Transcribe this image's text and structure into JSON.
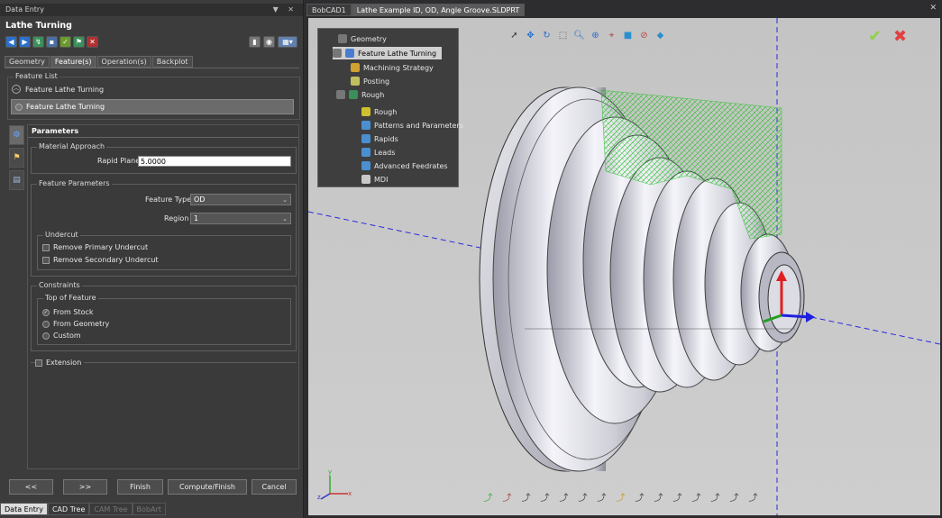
{
  "left_panel": {
    "pane_title": "Data Entry",
    "pane_btns": "▼ ✕",
    "feature_title": "Lathe Turning",
    "tabs": [
      "Geometry",
      "Feature(s)",
      "Operation(s)",
      "Backplot"
    ],
    "feature_list": {
      "legend": "Feature List",
      "group": "Feature Lathe Turning",
      "selected": "Feature Lathe Turning"
    },
    "params_header": "Parameters",
    "material_approach": {
      "legend": "Material Approach",
      "rapid_plane_label": "Rapid Plane",
      "rapid_plane_value": "5.0000"
    },
    "feature_parameters": {
      "legend": "Feature Parameters",
      "feature_type_label": "Feature Type",
      "feature_type_value": "OD",
      "region_label": "Region",
      "region_value": "1"
    },
    "undercut": {
      "legend": "Undercut",
      "remove_primary": "Remove Primary Undercut",
      "remove_secondary": "Remove Secondary Undercut"
    },
    "constraints": {
      "legend": "Constraints",
      "top_of_feature": "Top of Feature",
      "from_stock": "From Stock",
      "from_geometry": "From Geometry",
      "custom": "Custom"
    },
    "extension": "Extension",
    "buttons": {
      "prev": "<<",
      "next": ">>",
      "finish": "Finish",
      "compute_finish": "Compute/Finish",
      "cancel": "Cancel"
    },
    "dock_tabs": [
      "Data Entry",
      "CAD Tree",
      "CAM Tree",
      "BobArt"
    ]
  },
  "right_panel": {
    "tabs": [
      "BobCAD1",
      "Lathe Example ID, OD, Angle Groove.SLDPRT"
    ],
    "close": "✕",
    "tree": {
      "geometry": "Geometry",
      "feature": "Feature Lathe Turning",
      "machining_strategy": "Machining Strategy",
      "posting": "Posting",
      "rough": "Rough",
      "rough_child": "Rough",
      "patterns": "Patterns and Parameters",
      "rapids": "Rapids",
      "leads": "Leads",
      "advanced_feedrates": "Advanced Feedrates",
      "mdi": "MDI"
    },
    "triad": {
      "x": "x",
      "y": "y",
      "z": "z"
    }
  },
  "colors": {
    "accent_green": "#8fd14f",
    "cancel_red": "#e04040",
    "toolpath": "#3fdc3f",
    "axis_blue": "#2020e0"
  }
}
